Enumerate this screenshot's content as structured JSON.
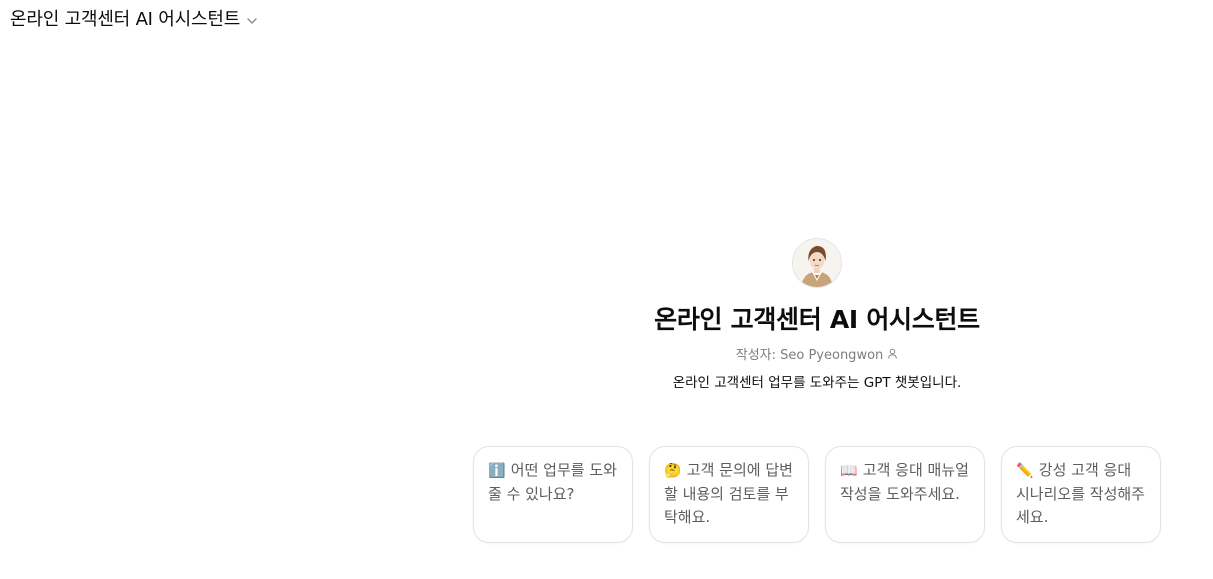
{
  "header": {
    "title": "온라인 고객센터 AI 어시스턴트",
    "chevron_icon": "chevron-down-icon"
  },
  "gpt": {
    "avatar_icon": "assistant-avatar",
    "name": "온라인 고객센터 AI 어시스턴트",
    "author_label": "작성자: Seo Pyeongwon",
    "author_icon": "person-icon",
    "description": "온라인 고객센터 업무를 도와주는 GPT 챗봇입니다."
  },
  "starters": [
    {
      "icon": "info-icon",
      "emoji": "ℹ️",
      "text": "어떤 업무를 도와줄 수 있나요?"
    },
    {
      "icon": "thinking-face-icon",
      "emoji": "🤔",
      "text": "고객 문의에 답변할 내용의 검토를 부탁해요."
    },
    {
      "icon": "book-icon",
      "emoji": "📖",
      "text": "고객 응대 매뉴얼 작성을 도와주세요."
    },
    {
      "icon": "pencil-icon",
      "emoji": "✏️",
      "text": "강성 고객 응대 시나리오를 작성해주세요."
    }
  ],
  "colors": {
    "text": "#0d0d0d",
    "muted": "#7d7d7d",
    "card_border": "#e3e3e3",
    "card_text": "#5d5d5d"
  }
}
